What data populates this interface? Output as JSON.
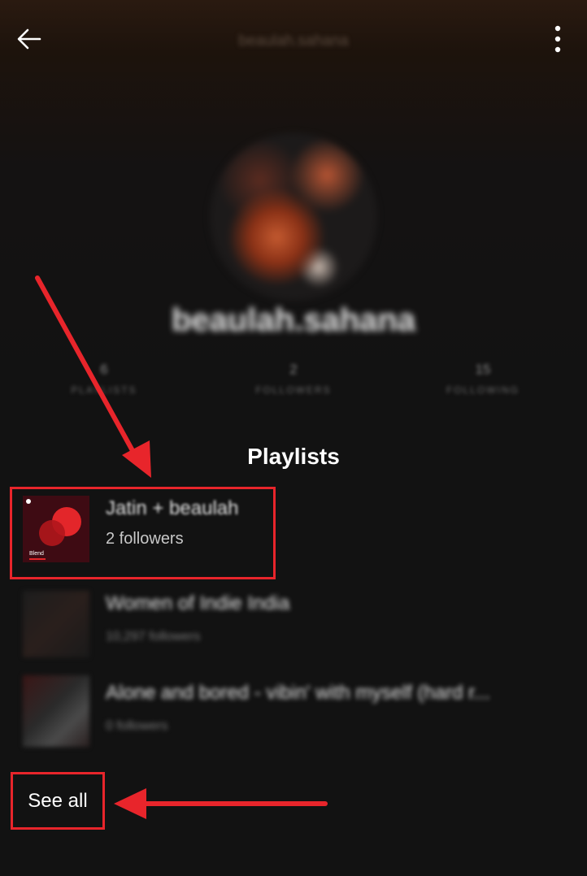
{
  "header": {
    "username": "beaulah.sahana",
    "back_icon": "arrow-left-icon",
    "more_icon": "more-vertical-icon"
  },
  "profile": {
    "name": "beaulah.sahana",
    "stats": [
      {
        "value": "6",
        "label": "PLAYLISTS"
      },
      {
        "value": "2",
        "label": "FOLLOWERS"
      },
      {
        "value": "15",
        "label": "FOLLOWING"
      }
    ]
  },
  "playlists": {
    "section_title": "Playlists",
    "items": [
      {
        "title": "Jatin + beaulah",
        "followers": "2 followers",
        "cover_label": "Blend"
      },
      {
        "title": "Women of Indie India",
        "followers": "10,297 followers"
      },
      {
        "title": "Alone and bored - vibin' with myself (hard r...",
        "followers": "0 followers"
      }
    ],
    "see_all_label": "See all"
  },
  "colors": {
    "background": "#121212",
    "annotation_red": "#e8252b",
    "blend_red": "#e3262a"
  }
}
